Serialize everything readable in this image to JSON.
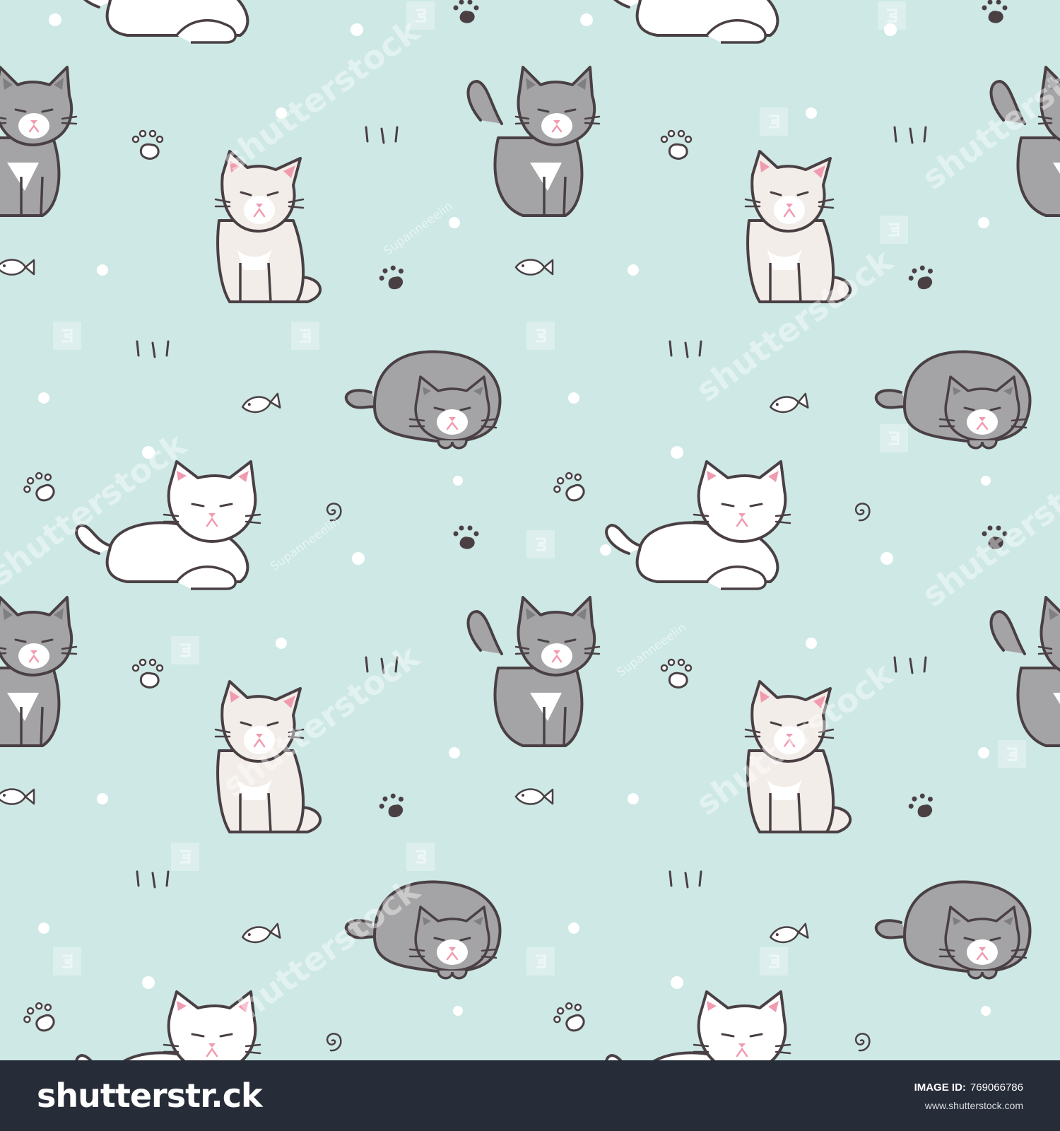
{
  "image": {
    "background_color": "#cde8e5",
    "outline_color": "#4a4044",
    "gray_cat_color": "#a4a4a6",
    "white_cat_color": "#ffffff",
    "cream_cat_color": "#f2ede8",
    "nose_color": "#f19bb0",
    "dot_color": "#ffffff",
    "watermark_text": "shutterstock",
    "watermark_author": "Supanneeelin"
  },
  "footer": {
    "background_color": "#262c38",
    "logo_text": "shutterstr.ck",
    "id_label": "IMAGE ID:",
    "id_value": "769066786",
    "url": "www.shutterstock.com"
  }
}
